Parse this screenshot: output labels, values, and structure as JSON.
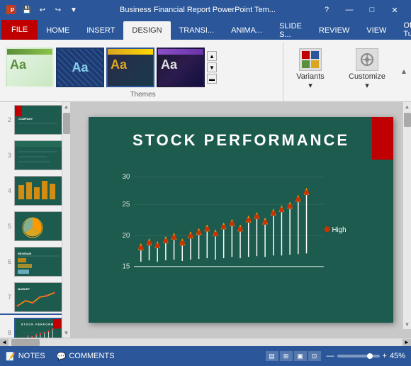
{
  "titleBar": {
    "title": "Business Financial Report PowerPoint Tem...",
    "controls": [
      "—",
      "□",
      "✕"
    ]
  },
  "ribbon": {
    "tabs": [
      "FILE",
      "HOME",
      "INSERT",
      "DESIGN",
      "TRANSI...",
      "ANIMA...",
      "SLIDE S...",
      "REVIEW",
      "VIEW"
    ],
    "activeTab": "DESIGN",
    "officeTab": "Office Tut...",
    "groups": {
      "themes": {
        "label": "Themes",
        "themes": [
          {
            "id": "theme1",
            "aa": "Aa"
          },
          {
            "id": "theme2",
            "aa": "Aa"
          },
          {
            "id": "theme3",
            "aa": "Aa",
            "selected": true
          },
          {
            "id": "theme4",
            "aa": "Aa"
          }
        ]
      },
      "variants": {
        "label": "Variants"
      },
      "customize": {
        "label": "Customize"
      }
    }
  },
  "slides": {
    "items": [
      {
        "num": "2"
      },
      {
        "num": "3"
      },
      {
        "num": "4"
      },
      {
        "num": "5"
      },
      {
        "num": "6"
      },
      {
        "num": "7"
      },
      {
        "num": "8",
        "active": true
      }
    ]
  },
  "slideContent": {
    "title": "STOCK PERFORMANCE",
    "chart": {
      "yAxisLabels": [
        "30",
        "25",
        "20",
        "15"
      ],
      "legendHigh": "High"
    }
  },
  "statusBar": {
    "notes": "NOTES",
    "comments": "COMMENTS",
    "zoom": "45%",
    "plus": "+",
    "minus": "—"
  }
}
